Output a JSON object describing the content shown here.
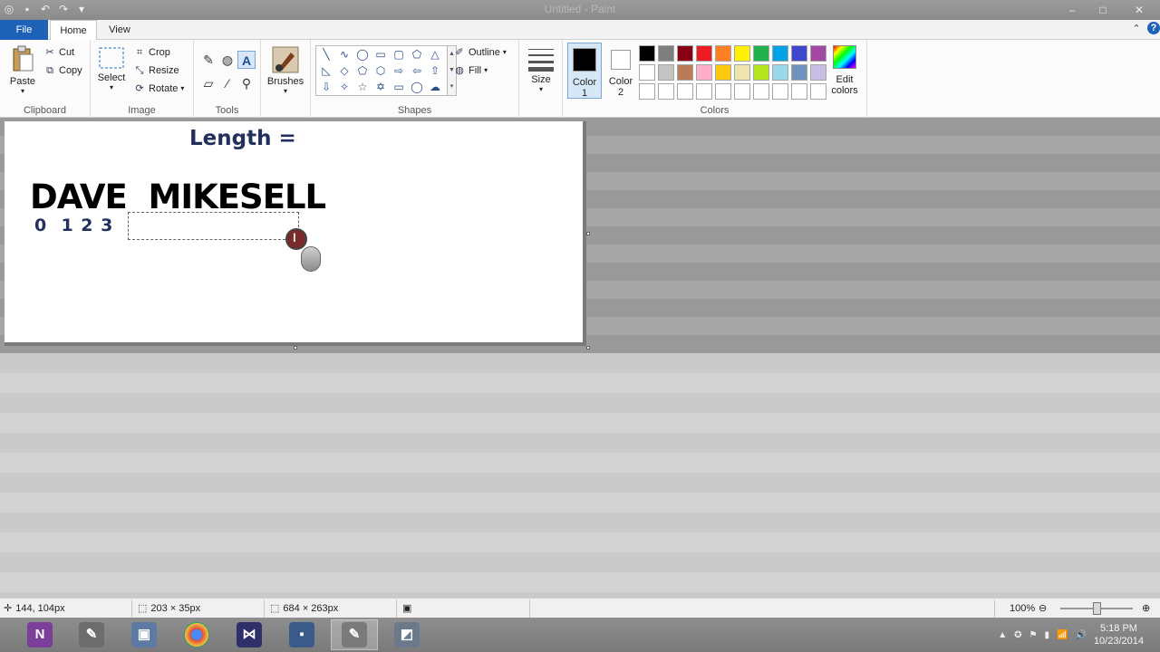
{
  "window": {
    "title": "Untitled - Paint",
    "controls": {
      "minimize": "–",
      "maximize": "□",
      "close": "✕"
    }
  },
  "tabs": {
    "file": "File",
    "home": "Home",
    "view": "View"
  },
  "ribbon": {
    "clipboard": {
      "paste": "Paste",
      "cut": "Cut",
      "copy": "Copy",
      "label": "Clipboard"
    },
    "image": {
      "select": "Select",
      "crop": "Crop",
      "resize": "Resize",
      "rotate": "Rotate",
      "label": "Image"
    },
    "tools": {
      "label": "Tools"
    },
    "brushes": {
      "label": "Brushes"
    },
    "shapes": {
      "outline": "Outline",
      "fill": "Fill",
      "label": "Shapes"
    },
    "size": {
      "label": "Size"
    },
    "colors": {
      "color1": "Color",
      "color1_num": "1",
      "color2": "Color",
      "color2_num": "2",
      "edit": "Edit",
      "edit2": "colors",
      "label": "Colors",
      "color1_value": "#000000",
      "color2_value": "#ffffff",
      "palette_row1": [
        "#000000",
        "#7f7f7f",
        "#880015",
        "#ed1c24",
        "#ff7f27",
        "#fff200",
        "#22b14c",
        "#00a2e8",
        "#3f48cc",
        "#a349a4"
      ],
      "palette_row2": [
        "#ffffff",
        "#c3c3c3",
        "#b97a57",
        "#ffaec9",
        "#ffc90e",
        "#efe4b0",
        "#b5e61d",
        "#99d9ea",
        "#7092be",
        "#c8bfe7"
      ],
      "palette_row3": [
        "#ffffff",
        "#ffffff",
        "#ffffff",
        "#ffffff",
        "#ffffff",
        "#ffffff",
        "#ffffff",
        "#ffffff",
        "#ffffff",
        "#ffffff"
      ]
    }
  },
  "canvas": {
    "length_label": "Length =",
    "name_text": "DAVE  MIKESELL",
    "index_text": "0  1 2 3"
  },
  "status": {
    "cursor_pos": "144, 104px",
    "selection_size": "203 × 35px",
    "image_size": "684 × 263px",
    "zoom": "100%"
  },
  "taskbar": {
    "apps": [
      "OneNote",
      "Paint.NET",
      "VirtualBox",
      "Chrome",
      "Visual Studio",
      "Save",
      "Paint",
      "App"
    ],
    "time": "5:18 PM",
    "date": "10/23/2014"
  }
}
